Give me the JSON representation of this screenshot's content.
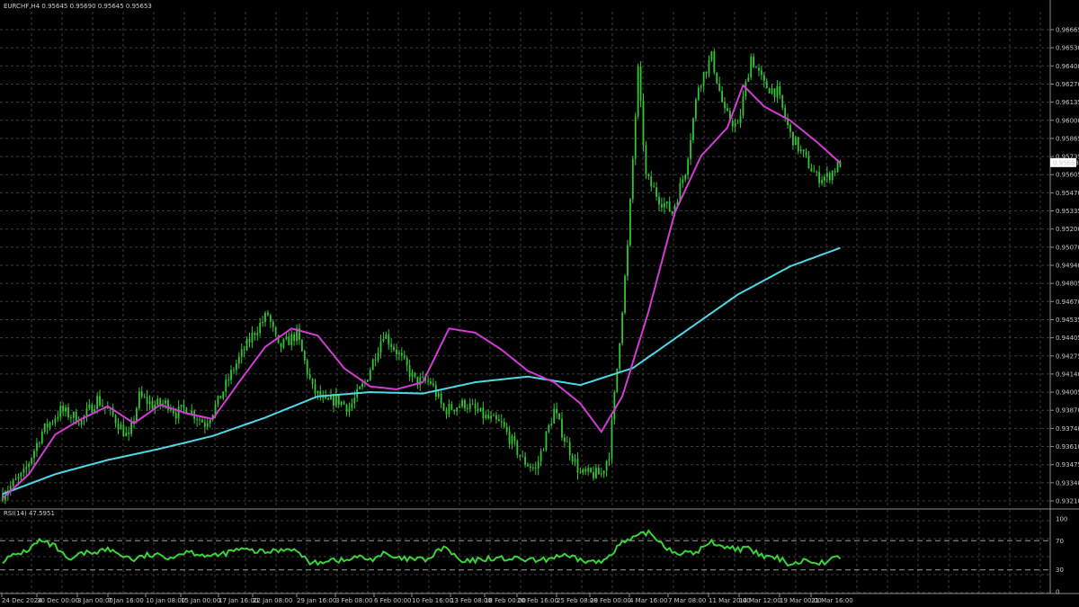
{
  "header": {
    "main": "EURCHF,H4  0.95645 0.95690 0.95645 0.95653",
    "rsi": "RSI(14) 47.5951"
  },
  "colors": {
    "background": "#000000",
    "grid": "#3c3c3c",
    "frame": "#8a8a8a",
    "candle": "#35c435",
    "ma_fast": "#d23cd2",
    "ma_slow": "#4fd8e6",
    "rsi": "#3bd23b",
    "rsi_levels": "#9a9a9a",
    "price_tag_bg": "#ffffff",
    "price_tag_text": "#000000"
  },
  "chart_data": {
    "type": "candlestick",
    "symbol": "EURCHF",
    "timeframe": "H4",
    "last_price": "0.95653",
    "y_ticks": [
      "0.96665",
      "0.96530",
      "0.96400",
      "0.96270",
      "0.96135",
      "0.96000",
      "0.95865",
      "0.95735",
      "0.95605",
      "0.95470",
      "0.95335",
      "0.95200",
      "0.95070",
      "0.94940",
      "0.94805",
      "0.94670",
      "0.94535",
      "0.94405",
      "0.94275",
      "0.94140",
      "0.94005",
      "0.93870",
      "0.93740",
      "0.93610",
      "0.93475",
      "0.93340",
      "0.93210"
    ],
    "ylim": [
      0.9321,
      0.9672
    ],
    "x_ticks": [
      "24 Dec 2024",
      "30 Dec 00:00",
      "3 Jan 00:00",
      "7 Jan 16:00",
      "10 Jan 08:00",
      "15 Jan 00:00",
      "17 Jan 16:00",
      "22 Jan 08:00",
      "29 Jan 16:00",
      "3 Feb 08:00",
      "6 Feb 00:00",
      "10 Feb 16:00",
      "13 Feb 08:00",
      "18 Feb 00:00",
      "20 Feb 16:00",
      "25 Feb 08:00",
      "28 Feb 00:00",
      "4 Mar 16:00",
      "7 Mar 08:00",
      "11 Mar 20:00",
      "14 Mar 12:00",
      "19 Mar 00:00",
      "21 Mar 16:00"
    ],
    "close_path": [
      [
        0,
        0.9331
      ],
      [
        8,
        0.9345
      ],
      [
        15,
        0.9375
      ],
      [
        22,
        0.939
      ],
      [
        30,
        0.9383
      ],
      [
        36,
        0.9398
      ],
      [
        42,
        0.9386
      ],
      [
        48,
        0.937
      ],
      [
        52,
        0.94
      ],
      [
        57,
        0.9394
      ],
      [
        63,
        0.9395
      ],
      [
        66,
        0.9388
      ],
      [
        70,
        0.9392
      ],
      [
        77,
        0.9381
      ],
      [
        82,
        0.9396
      ],
      [
        88,
        0.942
      ],
      [
        96,
        0.9446
      ],
      [
        101,
        0.9458
      ],
      [
        105,
        0.9434
      ],
      [
        112,
        0.9444
      ],
      [
        118,
        0.9405
      ],
      [
        123,
        0.9395
      ],
      [
        127,
        0.9398
      ],
      [
        132,
        0.9392
      ],
      [
        138,
        0.941
      ],
      [
        145,
        0.9445
      ],
      [
        150,
        0.9432
      ],
      [
        157,
        0.9411
      ],
      [
        163,
        0.941
      ],
      [
        168,
        0.939
      ],
      [
        176,
        0.9395
      ],
      [
        184,
        0.9385
      ],
      [
        190,
        0.938
      ],
      [
        198,
        0.9355
      ],
      [
        203,
        0.9348
      ],
      [
        207,
        0.9372
      ],
      [
        210,
        0.939
      ],
      [
        214,
        0.937
      ],
      [
        220,
        0.9345
      ],
      [
        228,
        0.9345
      ],
      [
        231,
        0.936
      ],
      [
        234,
        0.942
      ],
      [
        238,
        0.9505
      ],
      [
        242,
        0.963
      ],
      [
        245,
        0.9555
      ],
      [
        250,
        0.954
      ],
      [
        255,
        0.953
      ],
      [
        260,
        0.956
      ],
      [
        265,
        0.962
      ],
      [
        270,
        0.964
      ],
      [
        275,
        0.96
      ],
      [
        280,
        0.959
      ],
      [
        285,
        0.964
      ],
      [
        290,
        0.962
      ],
      [
        295,
        0.9615
      ],
      [
        300,
        0.9585
      ],
      [
        305,
        0.957
      ],
      [
        310,
        0.9555
      ],
      [
        314,
        0.9555
      ],
      [
        319,
        0.9565
      ]
    ],
    "ma_fast_path": [
      [
        0,
        0.9328
      ],
      [
        10,
        0.9345
      ],
      [
        20,
        0.9373
      ],
      [
        30,
        0.9384
      ],
      [
        40,
        0.9393
      ],
      [
        50,
        0.9381
      ],
      [
        60,
        0.9394
      ],
      [
        70,
        0.9388
      ],
      [
        80,
        0.9384
      ],
      [
        90,
        0.941
      ],
      [
        100,
        0.9435
      ],
      [
        110,
        0.9448
      ],
      [
        120,
        0.9443
      ],
      [
        130,
        0.942
      ],
      [
        140,
        0.9407
      ],
      [
        150,
        0.9405
      ],
      [
        160,
        0.941
      ],
      [
        170,
        0.9448
      ],
      [
        180,
        0.9445
      ],
      [
        190,
        0.9433
      ],
      [
        200,
        0.9418
      ],
      [
        210,
        0.941
      ],
      [
        220,
        0.9395
      ],
      [
        228,
        0.9375
      ],
      [
        236,
        0.94
      ],
      [
        246,
        0.946
      ],
      [
        256,
        0.953
      ],
      [
        266,
        0.957
      ],
      [
        276,
        0.959
      ],
      [
        282,
        0.962
      ],
      [
        290,
        0.9605
      ],
      [
        300,
        0.9595
      ],
      [
        310,
        0.958
      ],
      [
        319,
        0.9565
      ]
    ],
    "ma_slow_path": [
      [
        0,
        0.9331
      ],
      [
        20,
        0.9345
      ],
      [
        40,
        0.9355
      ],
      [
        60,
        0.9363
      ],
      [
        80,
        0.9372
      ],
      [
        100,
        0.9385
      ],
      [
        120,
        0.94
      ],
      [
        140,
        0.9403
      ],
      [
        160,
        0.9402
      ],
      [
        180,
        0.941
      ],
      [
        200,
        0.9414
      ],
      [
        220,
        0.9408
      ],
      [
        240,
        0.942
      ],
      [
        260,
        0.9446
      ],
      [
        280,
        0.9472
      ],
      [
        300,
        0.9492
      ],
      [
        319,
        0.9505
      ]
    ],
    "rsi_series": [
      [
        0,
        43
      ],
      [
        10,
        58
      ],
      [
        14,
        70
      ],
      [
        20,
        62
      ],
      [
        25,
        42
      ],
      [
        30,
        52
      ],
      [
        40,
        58
      ],
      [
        50,
        44
      ],
      [
        55,
        50
      ],
      [
        65,
        48
      ],
      [
        70,
        56
      ],
      [
        80,
        48
      ],
      [
        90,
        58
      ],
      [
        100,
        54
      ],
      [
        110,
        60
      ],
      [
        118,
        38
      ],
      [
        125,
        45
      ],
      [
        130,
        42
      ],
      [
        135,
        48
      ],
      [
        140,
        44
      ],
      [
        145,
        52
      ],
      [
        150,
        45
      ],
      [
        162,
        44
      ],
      [
        168,
        62
      ],
      [
        175,
        40
      ],
      [
        185,
        46
      ],
      [
        195,
        45
      ],
      [
        205,
        42
      ],
      [
        212,
        50
      ],
      [
        222,
        42
      ],
      [
        228,
        40
      ],
      [
        235,
        65
      ],
      [
        246,
        82
      ],
      [
        255,
        55
      ],
      [
        263,
        52
      ],
      [
        270,
        68
      ],
      [
        277,
        60
      ],
      [
        284,
        58
      ],
      [
        290,
        48
      ],
      [
        296,
        45
      ],
      [
        300,
        38
      ],
      [
        307,
        44
      ],
      [
        312,
        40
      ],
      [
        319,
        48
      ]
    ],
    "rsi_levels": [
      70,
      30
    ],
    "rsi_ticks": [
      "100",
      "70",
      "30",
      "0"
    ]
  }
}
